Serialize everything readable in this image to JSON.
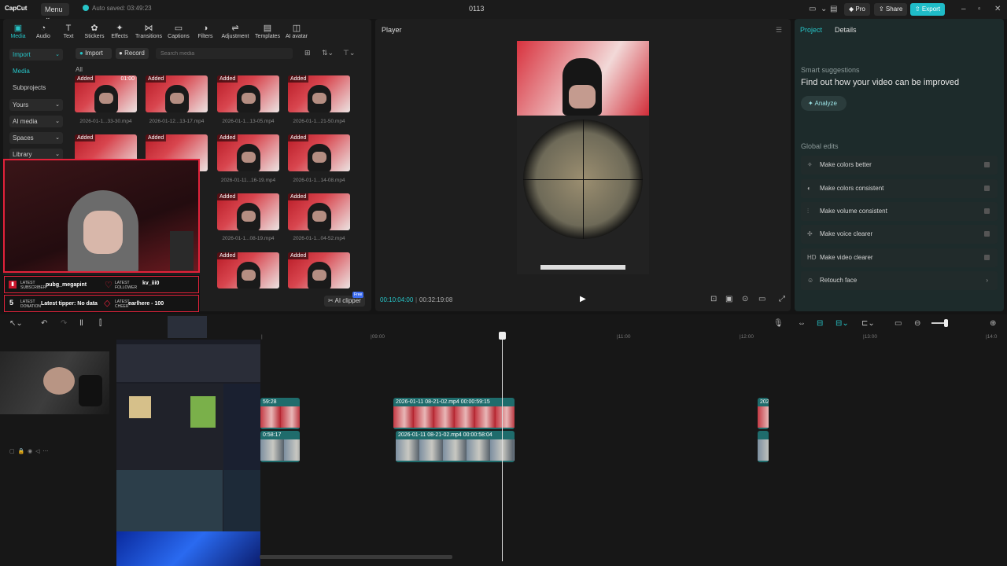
{
  "titlebar": {
    "logo": "CapCut",
    "menu": "Menu ⌄",
    "autosave": "Auto saved: 03:49:23",
    "title": "0113",
    "pro": "◆ Pro",
    "share": "⇪ Share",
    "export": "⇧ Export"
  },
  "tools": [
    {
      "icon": "▣",
      "label": "Media"
    },
    {
      "icon": "◔",
      "label": "Audio"
    },
    {
      "icon": "T",
      "label": "Text"
    },
    {
      "icon": "✿",
      "label": "Stickers"
    },
    {
      "icon": "✦",
      "label": "Effects"
    },
    {
      "icon": "⋈",
      "label": "Transitions"
    },
    {
      "icon": "▭",
      "label": "Captions"
    },
    {
      "icon": "◑",
      "label": "Filters"
    },
    {
      "icon": "⇌",
      "label": "Adjustment"
    },
    {
      "icon": "▤",
      "label": "Templates"
    },
    {
      "icon": "◫",
      "label": "AI avatar"
    }
  ],
  "nav": {
    "import": "Import",
    "media": "Media",
    "subprojects": "Subprojects",
    "yours": "Yours",
    "ai_media": "AI media",
    "spaces": "Spaces",
    "library": "Library"
  },
  "media": {
    "import_btn": "Import",
    "record_btn": "Record",
    "search_placeholder": "Search media",
    "all": "All",
    "added": "Added",
    "ai_clipper": "AI clipper",
    "free": "Free",
    "items": [
      {
        "name": "2026-01-1...33-30.mp4",
        "dur": "01:00"
      },
      {
        "name": "2026-01-12...13-17.mp4",
        "dur": ""
      },
      {
        "name": "2026-01-1...13-05.mp4",
        "dur": ""
      },
      {
        "name": "2026-01-1...21-50.mp4",
        "dur": ""
      },
      {
        "name": "2026-01-11...16-19.mp4",
        "dur": ""
      },
      {
        "name": "2026-01-1...14-08.mp4",
        "dur": ""
      },
      {
        "name": "2026-01-1...08-19.mp4",
        "dur": ""
      },
      {
        "name": "2026-01-1...04-52.mp4",
        "dur": ""
      }
    ]
  },
  "stream": {
    "sub_label": "LATEST SUBSCRIBER",
    "sub_val": "pubg_megapint",
    "fol_label": "LATEST FOLLOWER",
    "fol_val": "kv_iii0",
    "don_label": "LATEST DONATION",
    "don_val": "Latest tipper: No data",
    "cheer_label": "LATEST CHEER",
    "cheer_val": "earlhere - 100",
    "num": "5"
  },
  "player": {
    "label": "Player",
    "time_current": "00:10:04:00",
    "time_total": "00:32:19:08",
    "play": "▶"
  },
  "right": {
    "tab_project": "Project",
    "tab_details": "Details",
    "smart_title": "Smart suggestions",
    "smart_text": "Find out how your video can be improved",
    "analyze": "Analyze",
    "global_title": "Global edits",
    "edits": [
      {
        "icon": "✧",
        "label": "Make colors better"
      },
      {
        "icon": "◐",
        "label": "Make colors consistent"
      },
      {
        "icon": "⫶",
        "label": "Make volume consistent"
      },
      {
        "icon": "✢",
        "label": "Make voice clearer"
      },
      {
        "icon": "HD",
        "label": "Make video clearer"
      },
      {
        "icon": "☺",
        "label": "Retouch face"
      }
    ]
  },
  "timeline": {
    "ruler": [
      "|09:00",
      "|11:00",
      "|12:00",
      "|13:00",
      "|14:0"
    ],
    "clip1_label": "2026-01-11 08-21-02.mp4  00:00:59:15",
    "clip2_label": "2026-01-11 08-21-02.mp4  00:00:58:04",
    "clip_left1": "59:28",
    "clip_left2": "0:58:17",
    "clip_right": "202"
  }
}
